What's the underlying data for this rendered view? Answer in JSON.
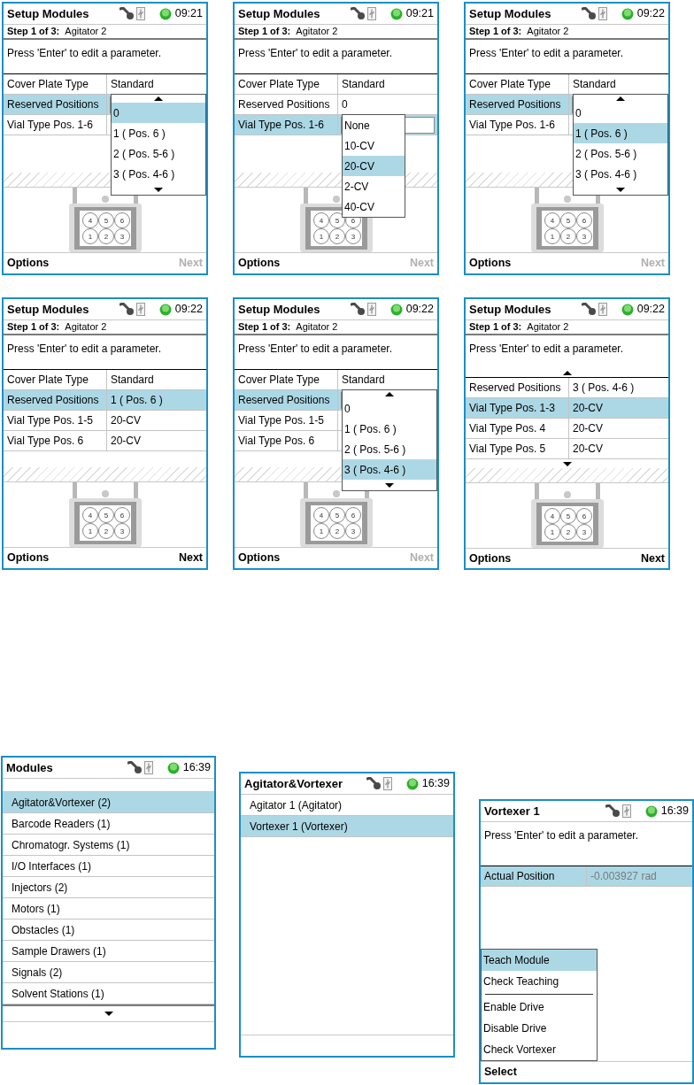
{
  "screens": [
    {
      "kind": "setup",
      "title": "Setup Modules",
      "time": "09:21",
      "step_label": "Step 1 of 3:",
      "step_value": "Agitator 2",
      "instruction": "Press 'Enter' to edit a parameter.",
      "rows": [
        {
          "label": "Cover Plate Type",
          "value": "Standard",
          "selected": false
        },
        {
          "label": "Reserved Positions",
          "selected": true
        },
        {
          "label": "Vial Type Pos. 1-6",
          "selected": false
        }
      ],
      "dropdown": {
        "scroll_up": true,
        "scroll_down": true,
        "items": [
          {
            "label": "0",
            "selected": true
          },
          {
            "label": "1 ( Pos. 6 )",
            "selected": false
          },
          {
            "label": "2 ( Pos. 5-6 )",
            "selected": false
          },
          {
            "label": "3 ( Pos. 4-6 )",
            "selected": false
          }
        ]
      },
      "tray_labels": [
        "4",
        "5",
        "6",
        "1",
        "2",
        "3"
      ],
      "soft_keys": [
        {
          "label": "Options",
          "disabled": false
        },
        {
          "label": "Next",
          "disabled": true
        }
      ]
    },
    {
      "kind": "setup",
      "title": "Setup Modules",
      "time": "09:21",
      "step_label": "Step 1 of 3:",
      "step_value": "Agitator 2",
      "instruction": "Press 'Enter' to edit a parameter.",
      "rows": [
        {
          "label": "Cover Plate Type",
          "value": "Standard",
          "selected": false
        },
        {
          "label": "Reserved Positions",
          "value": "0",
          "selected": false
        },
        {
          "label": "Vial Type Pos. 1-6",
          "selected": true
        }
      ],
      "dropdown": {
        "items": [
          {
            "label": "None",
            "selected": false
          },
          {
            "label": "10-CV",
            "selected": false
          },
          {
            "label": "20-CV",
            "selected": true
          },
          {
            "label": "2-CV",
            "selected": false
          },
          {
            "label": "40-CV",
            "selected": false
          }
        ]
      },
      "tray_labels": [
        "4",
        "5",
        "6",
        "1",
        "2",
        "3"
      ],
      "soft_keys": [
        {
          "label": "Options",
          "disabled": false
        },
        {
          "label": "Next",
          "disabled": true
        }
      ]
    },
    {
      "kind": "setup",
      "title": "Setup Modules",
      "time": "09:22",
      "step_label": "Step 1 of 3:",
      "step_value": "Agitator 2",
      "instruction": "Press 'Enter' to edit a parameter.",
      "rows": [
        {
          "label": "Cover Plate Type",
          "value": "Standard",
          "selected": false
        },
        {
          "label": "Reserved Positions",
          "selected": true
        },
        {
          "label": "Vial Type Pos. 1-6",
          "selected": false
        }
      ],
      "dropdown": {
        "scroll_up": true,
        "scroll_down": true,
        "items": [
          {
            "label": "0",
            "selected": false
          },
          {
            "label": "1 ( Pos. 6 )",
            "selected": true
          },
          {
            "label": "2 ( Pos. 5-6 )",
            "selected": false
          },
          {
            "label": "3 ( Pos. 4-6 )",
            "selected": false
          }
        ]
      },
      "tray_labels": [
        "4",
        "5",
        "6",
        "1",
        "2",
        "3"
      ],
      "soft_keys": [
        {
          "label": "Options",
          "disabled": false
        },
        {
          "label": "Next",
          "disabled": true
        }
      ]
    },
    {
      "kind": "setup",
      "title": "Setup Modules",
      "time": "09:22",
      "step_label": "Step 1 of 3:",
      "step_value": "Agitator 2",
      "instruction": "Press 'Enter' to edit a parameter.",
      "rows": [
        {
          "label": "Cover Plate Type",
          "value": "Standard",
          "selected": false
        },
        {
          "label": "Reserved Positions",
          "value": "1 ( Pos. 6 )",
          "selected": true
        },
        {
          "label": "Vial Type Pos. 1-5",
          "value": "20-CV",
          "selected": false
        },
        {
          "label": "Vial Type Pos. 6",
          "value": "20-CV",
          "selected": false
        }
      ],
      "tray_labels": [
        "4",
        "5",
        "6",
        "1",
        "2",
        "3"
      ],
      "soft_keys": [
        {
          "label": "Options",
          "disabled": false
        },
        {
          "label": "Next",
          "disabled": false
        }
      ]
    },
    {
      "kind": "setup",
      "title": "Setup Modules",
      "time": "09:22",
      "step_label": "Step 1 of 3:",
      "step_value": "Agitator 2",
      "instruction": "Press 'Enter' to edit a parameter.",
      "rows": [
        {
          "label": "Cover Plate Type",
          "value": "Standard",
          "selected": false
        },
        {
          "label": "Reserved Positions",
          "selected": true
        },
        {
          "label": "Vial Type Pos. 1-5",
          "selected": false
        },
        {
          "label": "Vial Type Pos. 6",
          "selected": false
        }
      ],
      "dropdown": {
        "scroll_up": true,
        "scroll_down": true,
        "items": [
          {
            "label": "0",
            "selected": false
          },
          {
            "label": "1 ( Pos. 6 )",
            "selected": false
          },
          {
            "label": "2 ( Pos. 5-6 )",
            "selected": false
          },
          {
            "label": "3 ( Pos. 4-6 )",
            "selected": true
          }
        ]
      },
      "tray_labels": [
        "4",
        "5",
        "6",
        "1",
        "2",
        "3"
      ],
      "soft_keys": [
        {
          "label": "Options",
          "disabled": false
        },
        {
          "label": "Next",
          "disabled": true
        }
      ]
    },
    {
      "kind": "setup",
      "title": "Setup Modules",
      "time": "09:22",
      "step_label": "Step 1 of 3:",
      "step_value": "Agitator 2",
      "instruction": "Press 'Enter' to edit a parameter.",
      "scroll_up": true,
      "scroll_down": true,
      "rows": [
        {
          "label": "Reserved Positions",
          "value": "3 ( Pos. 4-6 )",
          "selected": false
        },
        {
          "label": "Vial Type Pos. 1-3",
          "value": "20-CV",
          "selected": true
        },
        {
          "label": "Vial Type Pos. 4",
          "value": "20-CV",
          "selected": false
        },
        {
          "label": "Vial Type Pos. 5",
          "value": "20-CV",
          "selected": false
        }
      ],
      "tray_labels": [
        "4",
        "5",
        "6",
        "1",
        "2",
        "3"
      ],
      "soft_keys": [
        {
          "label": "Options",
          "disabled": false
        },
        {
          "label": "Next",
          "disabled": false
        }
      ]
    },
    {
      "kind": "list",
      "title": "Modules",
      "time": "16:39",
      "scroll_down": true,
      "items": [
        {
          "label": "Agitator&Vortexer (2)",
          "selected": true
        },
        {
          "label": "Barcode Readers (1)",
          "selected": false
        },
        {
          "label": "Chromatogr. Systems (1)",
          "selected": false
        },
        {
          "label": "I/O Interfaces (1)",
          "selected": false
        },
        {
          "label": "Injectors (2)",
          "selected": false
        },
        {
          "label": "Motors (1)",
          "selected": false
        },
        {
          "label": "Obstacles (1)",
          "selected": false
        },
        {
          "label": "Sample Drawers (1)",
          "selected": false
        },
        {
          "label": "Signals (2)",
          "selected": false
        },
        {
          "label": "Solvent Stations (1)",
          "selected": false
        }
      ]
    },
    {
      "kind": "list",
      "title": "Agitator&Vortexer",
      "time": "16:39",
      "items": [
        {
          "label": "Agitator 1 (Agitator)",
          "selected": false
        },
        {
          "label": "Vortexer 1 (Vortexer)",
          "selected": true
        }
      ]
    },
    {
      "kind": "detail",
      "title": "Vortexer 1",
      "time": "16:39",
      "instruction": "Press 'Enter' to edit a parameter.",
      "rows": [
        {
          "label": "Actual Position",
          "value": "-0.003927 rad",
          "selected": true,
          "disabled": true
        }
      ],
      "menu": [
        {
          "kind": "item",
          "label": "Teach Module",
          "selected": true
        },
        {
          "kind": "item",
          "label": "Check Teaching",
          "selected": false
        },
        {
          "kind": "separator"
        },
        {
          "kind": "item",
          "label": "Enable Drive",
          "selected": false
        },
        {
          "kind": "item",
          "label": "Disable Drive",
          "selected": false
        },
        {
          "kind": "item",
          "label": "Check Vortexer",
          "selected": false
        }
      ],
      "soft_keys": [
        {
          "label": "Select",
          "disabled": false
        }
      ]
    }
  ]
}
